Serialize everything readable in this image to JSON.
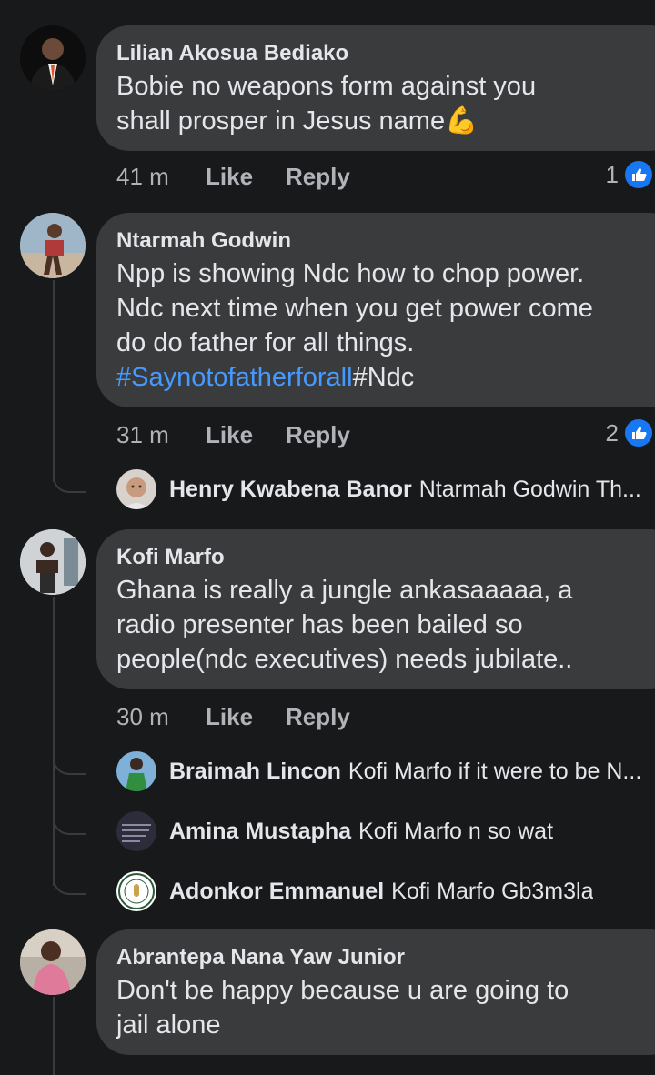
{
  "comments": [
    {
      "name": "Lilian Akosua Bediako",
      "text_line1": "Bobie no weapons form against you",
      "text_line2": "shall prosper in Jesus name",
      "emoji": "💪",
      "time": "41 m",
      "like_label": "Like",
      "reply_label": "Reply",
      "reactions": "1"
    },
    {
      "name": "Ntarmah Godwin",
      "text_line1": "Npp is showing Ndc how to chop power.",
      "text_line2": "Ndc next time when you get power come",
      "text_line3": "do do father for all things.",
      "hashtag": "#Saynotofatherforall",
      "hashtag_tail": "#Ndc",
      "time": "31 m",
      "like_label": "Like",
      "reply_label": "Reply",
      "reactions": "2",
      "replies": [
        {
          "name": "Henry Kwabena Banor",
          "text": "Ntarmah Godwin Th..."
        }
      ]
    },
    {
      "name": "Kofi Marfo",
      "text_line1": "Ghana is really a jungle ankasaaaaa, a",
      "text_line2": "radio presenter has been bailed so",
      "text_line3": "people(ndc executives) needs jubilate..",
      "time": "30 m",
      "like_label": "Like",
      "reply_label": "Reply",
      "replies": [
        {
          "name": "Braimah Lincon",
          "text": "Kofi Marfo if it were to be N..."
        },
        {
          "name": "Amina Mustapha",
          "text": "Kofi Marfo  n so wat"
        },
        {
          "name": "Adonkor Emmanuel",
          "text": "Kofi Marfo Gb3m3la"
        }
      ]
    },
    {
      "name": "Abrantepa Nana Yaw Junior",
      "text_line1": "Don't be happy because u are going to",
      "text_line2": "jail alone"
    }
  ],
  "colors": {
    "background": "#18191a",
    "bubble": "#3a3b3c",
    "hashtag": "#4599ff",
    "like_badge": "#1877f2"
  }
}
